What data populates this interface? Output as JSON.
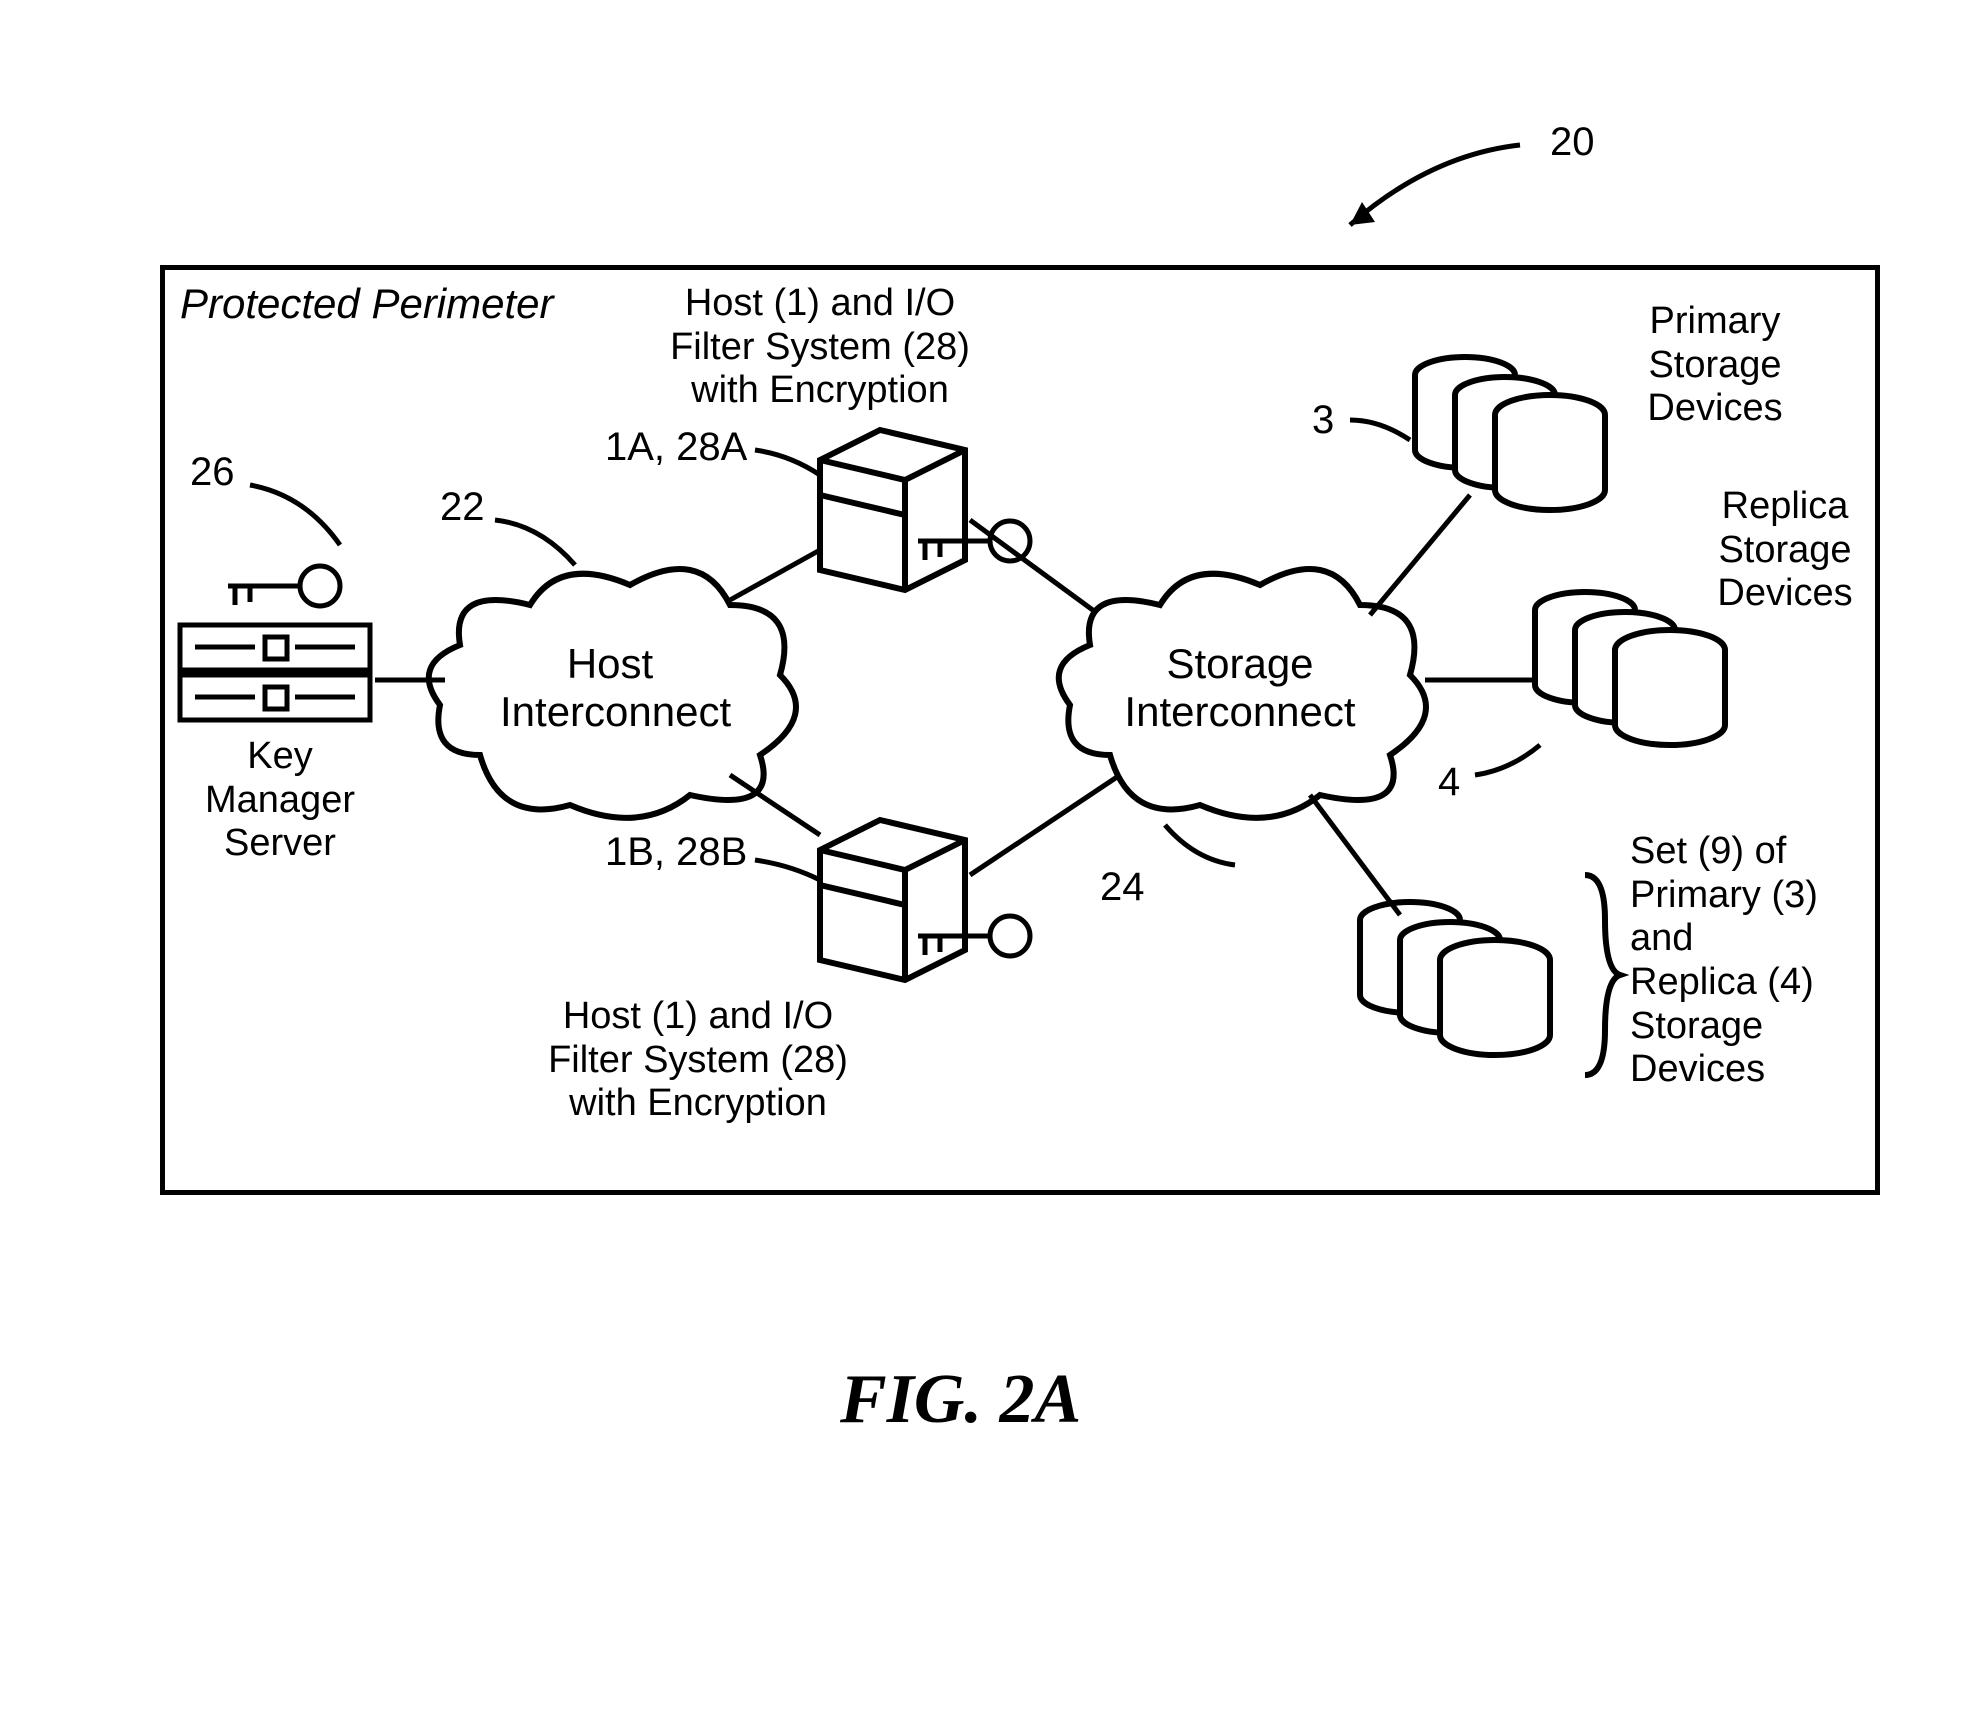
{
  "figure_caption": "FIG. 2A",
  "perimeter_title": "Protected Perimeter",
  "ref20": "20",
  "ref26": "26",
  "ref22": "22",
  "ref1A28A": "1A, 28A",
  "ref1B28B": "1B, 28B",
  "ref24": "24",
  "ref3": "3",
  "ref4": "4",
  "key_manager_label": "Key Manager\nServer",
  "host_interconnect_label": "Host\nInterconnect",
  "storage_interconnect_label": "Storage\nInterconnect",
  "host_top_label": "Host (1) and I/O\nFilter System (28)\nwith Encryption",
  "host_bottom_label": "Host (1) and I/O\nFilter System (28)\nwith Encryption",
  "primary_storage_label": "Primary\nStorage\nDevices",
  "replica_storage_label": "Replica\nStorage\nDevices",
  "set9_label": "Set (9) of\nPrimary (3)\nand\nReplica (4)\nStorage\nDevices"
}
